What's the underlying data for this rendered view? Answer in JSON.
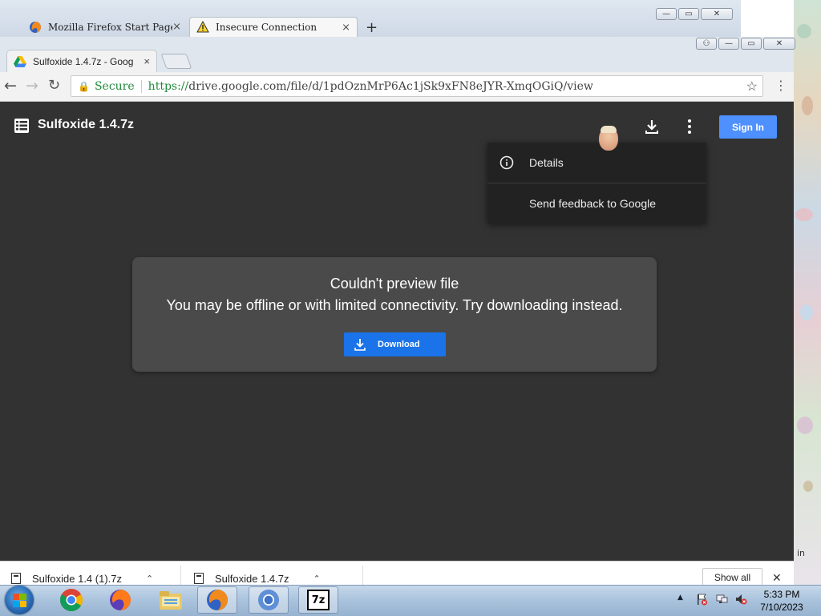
{
  "firefox": {
    "tabs": [
      {
        "label": "Mozilla Firefox Start Page",
        "close": "×"
      },
      {
        "label": "Insecure Connection",
        "close": "×"
      }
    ],
    "new_tab": "+",
    "window_buttons": {
      "minimize": "—",
      "restore": "▭",
      "close": "✕"
    }
  },
  "chrome": {
    "tab": {
      "label": "Sulfoxide 1.4.7z - Goog",
      "close": "×"
    },
    "omnibox": {
      "secure_label": "Secure",
      "scheme": "https://",
      "url": "drive.google.com/file/d/1pdOznMrP6Ac1jSk9xFN8eJYR-XmqOGiQ/view"
    },
    "window_buttons": {
      "user": "⚇",
      "minimize": "—",
      "restore": "▭",
      "close": "✕"
    }
  },
  "viewer": {
    "file_title": "Sulfoxide 1.4.7z",
    "sign_in_label": "Sign In",
    "menu": {
      "details_label": "Details",
      "feedback_label": "Send feedback to Google"
    },
    "error": {
      "title": "Couldn't preview file",
      "message": "You may be offline or with limited connectivity. Try downloading instead.",
      "download_label": "Download"
    },
    "colors": {
      "background": "#323232",
      "card": "#4a4a4a",
      "primary_button": "#1a73e8",
      "sign_in": "#4d90fe"
    }
  },
  "downloads_bar": {
    "items": [
      {
        "name": "Sulfoxide 1.4 (1).7z"
      },
      {
        "name": "Sulfoxide 1.4.7z"
      }
    ],
    "show_all_label": "Show all",
    "close": "✕"
  },
  "taskbar": {
    "clock_time": "5:33 PM",
    "clock_date": "7/10/2023",
    "pinned": [
      "chrome-icon",
      "firefox-icon",
      "file-explorer-icon",
      "firefox-icon",
      "chromium-icon",
      "7zip-icon"
    ],
    "zip_label": "7z"
  },
  "wallpaper_text": "in"
}
